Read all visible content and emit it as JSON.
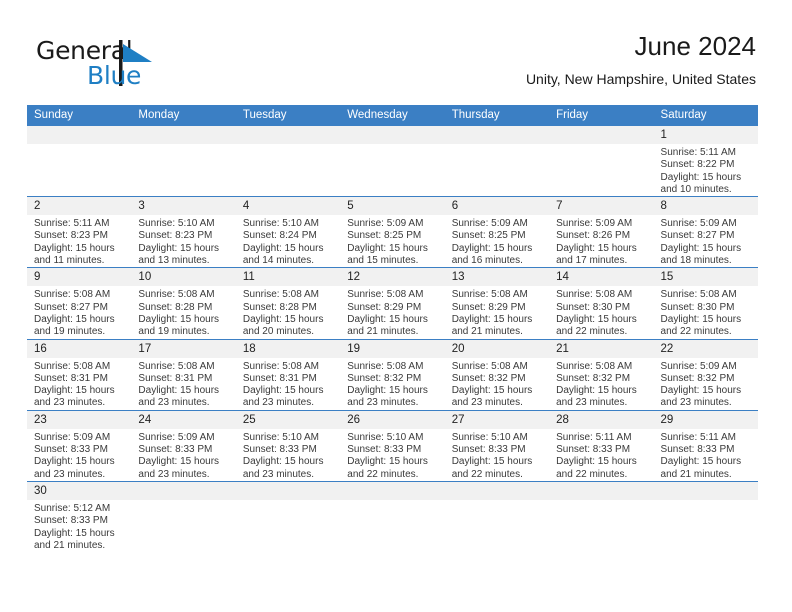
{
  "brand": {
    "name_top": "General",
    "name_bottom": "Blue",
    "flag_icon": "triangle-flag-icon",
    "color_top": "#1a1a1a",
    "color_bottom": "#1f7fc4"
  },
  "header": {
    "title": "June 2024",
    "subtitle": "Unity, New Hampshire, United States"
  },
  "colors": {
    "header_row_bg": "#3b7fc4",
    "header_row_text": "#ffffff",
    "daynum_bg": "#f1f1f1",
    "row_separator": "#3b7fc4",
    "body_text": "#3a3a3a"
  },
  "calendar": {
    "weekday_headers": [
      "Sunday",
      "Monday",
      "Tuesday",
      "Wednesday",
      "Thursday",
      "Friday",
      "Saturday"
    ],
    "weeks": [
      [
        {
          "day": "",
          "lines": []
        },
        {
          "day": "",
          "lines": []
        },
        {
          "day": "",
          "lines": []
        },
        {
          "day": "",
          "lines": []
        },
        {
          "day": "",
          "lines": []
        },
        {
          "day": "",
          "lines": []
        },
        {
          "day": "1",
          "lines": [
            "Sunrise: 5:11 AM",
            "Sunset: 8:22 PM",
            "Daylight: 15 hours",
            "and 10 minutes."
          ]
        }
      ],
      [
        {
          "day": "2",
          "lines": [
            "Sunrise: 5:11 AM",
            "Sunset: 8:23 PM",
            "Daylight: 15 hours",
            "and 11 minutes."
          ]
        },
        {
          "day": "3",
          "lines": [
            "Sunrise: 5:10 AM",
            "Sunset: 8:23 PM",
            "Daylight: 15 hours",
            "and 13 minutes."
          ]
        },
        {
          "day": "4",
          "lines": [
            "Sunrise: 5:10 AM",
            "Sunset: 8:24 PM",
            "Daylight: 15 hours",
            "and 14 minutes."
          ]
        },
        {
          "day": "5",
          "lines": [
            "Sunrise: 5:09 AM",
            "Sunset: 8:25 PM",
            "Daylight: 15 hours",
            "and 15 minutes."
          ]
        },
        {
          "day": "6",
          "lines": [
            "Sunrise: 5:09 AM",
            "Sunset: 8:25 PM",
            "Daylight: 15 hours",
            "and 16 minutes."
          ]
        },
        {
          "day": "7",
          "lines": [
            "Sunrise: 5:09 AM",
            "Sunset: 8:26 PM",
            "Daylight: 15 hours",
            "and 17 minutes."
          ]
        },
        {
          "day": "8",
          "lines": [
            "Sunrise: 5:09 AM",
            "Sunset: 8:27 PM",
            "Daylight: 15 hours",
            "and 18 minutes."
          ]
        }
      ],
      [
        {
          "day": "9",
          "lines": [
            "Sunrise: 5:08 AM",
            "Sunset: 8:27 PM",
            "Daylight: 15 hours",
            "and 19 minutes."
          ]
        },
        {
          "day": "10",
          "lines": [
            "Sunrise: 5:08 AM",
            "Sunset: 8:28 PM",
            "Daylight: 15 hours",
            "and 19 minutes."
          ]
        },
        {
          "day": "11",
          "lines": [
            "Sunrise: 5:08 AM",
            "Sunset: 8:28 PM",
            "Daylight: 15 hours",
            "and 20 minutes."
          ]
        },
        {
          "day": "12",
          "lines": [
            "Sunrise: 5:08 AM",
            "Sunset: 8:29 PM",
            "Daylight: 15 hours",
            "and 21 minutes."
          ]
        },
        {
          "day": "13",
          "lines": [
            "Sunrise: 5:08 AM",
            "Sunset: 8:29 PM",
            "Daylight: 15 hours",
            "and 21 minutes."
          ]
        },
        {
          "day": "14",
          "lines": [
            "Sunrise: 5:08 AM",
            "Sunset: 8:30 PM",
            "Daylight: 15 hours",
            "and 22 minutes."
          ]
        },
        {
          "day": "15",
          "lines": [
            "Sunrise: 5:08 AM",
            "Sunset: 8:30 PM",
            "Daylight: 15 hours",
            "and 22 minutes."
          ]
        }
      ],
      [
        {
          "day": "16",
          "lines": [
            "Sunrise: 5:08 AM",
            "Sunset: 8:31 PM",
            "Daylight: 15 hours",
            "and 23 minutes."
          ]
        },
        {
          "day": "17",
          "lines": [
            "Sunrise: 5:08 AM",
            "Sunset: 8:31 PM",
            "Daylight: 15 hours",
            "and 23 minutes."
          ]
        },
        {
          "day": "18",
          "lines": [
            "Sunrise: 5:08 AM",
            "Sunset: 8:31 PM",
            "Daylight: 15 hours",
            "and 23 minutes."
          ]
        },
        {
          "day": "19",
          "lines": [
            "Sunrise: 5:08 AM",
            "Sunset: 8:32 PM",
            "Daylight: 15 hours",
            "and 23 minutes."
          ]
        },
        {
          "day": "20",
          "lines": [
            "Sunrise: 5:08 AM",
            "Sunset: 8:32 PM",
            "Daylight: 15 hours",
            "and 23 minutes."
          ]
        },
        {
          "day": "21",
          "lines": [
            "Sunrise: 5:08 AM",
            "Sunset: 8:32 PM",
            "Daylight: 15 hours",
            "and 23 minutes."
          ]
        },
        {
          "day": "22",
          "lines": [
            "Sunrise: 5:09 AM",
            "Sunset: 8:32 PM",
            "Daylight: 15 hours",
            "and 23 minutes."
          ]
        }
      ],
      [
        {
          "day": "23",
          "lines": [
            "Sunrise: 5:09 AM",
            "Sunset: 8:33 PM",
            "Daylight: 15 hours",
            "and 23 minutes."
          ]
        },
        {
          "day": "24",
          "lines": [
            "Sunrise: 5:09 AM",
            "Sunset: 8:33 PM",
            "Daylight: 15 hours",
            "and 23 minutes."
          ]
        },
        {
          "day": "25",
          "lines": [
            "Sunrise: 5:10 AM",
            "Sunset: 8:33 PM",
            "Daylight: 15 hours",
            "and 23 minutes."
          ]
        },
        {
          "day": "26",
          "lines": [
            "Sunrise: 5:10 AM",
            "Sunset: 8:33 PM",
            "Daylight: 15 hours",
            "and 22 minutes."
          ]
        },
        {
          "day": "27",
          "lines": [
            "Sunrise: 5:10 AM",
            "Sunset: 8:33 PM",
            "Daylight: 15 hours",
            "and 22 minutes."
          ]
        },
        {
          "day": "28",
          "lines": [
            "Sunrise: 5:11 AM",
            "Sunset: 8:33 PM",
            "Daylight: 15 hours",
            "and 22 minutes."
          ]
        },
        {
          "day": "29",
          "lines": [
            "Sunrise: 5:11 AM",
            "Sunset: 8:33 PM",
            "Daylight: 15 hours",
            "and 21 minutes."
          ]
        }
      ],
      [
        {
          "day": "30",
          "lines": [
            "Sunrise: 5:12 AM",
            "Sunset: 8:33 PM",
            "Daylight: 15 hours",
            "and 21 minutes."
          ]
        },
        {
          "day": "",
          "lines": []
        },
        {
          "day": "",
          "lines": []
        },
        {
          "day": "",
          "lines": []
        },
        {
          "day": "",
          "lines": []
        },
        {
          "day": "",
          "lines": []
        },
        {
          "day": "",
          "lines": []
        }
      ]
    ]
  }
}
